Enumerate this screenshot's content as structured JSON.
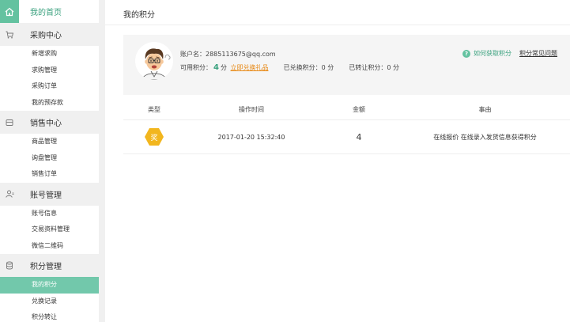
{
  "sidebar": {
    "home": {
      "label": "我的首页",
      "icon": "home-icon"
    },
    "sections": [
      {
        "label": "采购中心",
        "icon": "cart-icon",
        "items": [
          "新增求购",
          "求购管理",
          "采购订单",
          "我的预存款"
        ]
      },
      {
        "label": "销售中心",
        "icon": "box-icon",
        "items": [
          "商品管理",
          "询盘管理",
          "销售订单"
        ]
      },
      {
        "label": "账号管理",
        "icon": "user-icon",
        "items": [
          "账号信息",
          "交易资料管理",
          "微信二维码"
        ]
      },
      {
        "label": "积分管理",
        "icon": "coins-icon",
        "items": [
          "我的积分",
          "兑换记录",
          "积分转让"
        ],
        "active_item": "我的积分"
      }
    ]
  },
  "main": {
    "title": "我的积分",
    "account": {
      "name_label": "账户名：",
      "name_value": "2885113675@qq.com",
      "available_label": "可用积分：",
      "available_value": "4",
      "unit": "分",
      "redeem_link": "立即兑换礼品",
      "exchanged_label": "已兑换积分：",
      "exchanged_value": "0",
      "transferred_label": "已转让积分：",
      "transferred_value": "0",
      "help_link": "如何获取积分",
      "faq_link": "积分常见问题"
    },
    "table": {
      "headers": [
        "类型",
        "操作时间",
        "金额",
        "事由"
      ],
      "rows": [
        {
          "type_badge": "奖",
          "time": "2017-01-20 15:32:40",
          "amount": "4",
          "reason": "在线报价 在线录入发货信息获得积分"
        }
      ]
    }
  },
  "colors": {
    "accent": "#64c2a0",
    "accent_text": "#3aa17e",
    "active_item_bg": "#72c8ab",
    "badge": "#f2b61e",
    "redeem_link": "#e88a17"
  }
}
